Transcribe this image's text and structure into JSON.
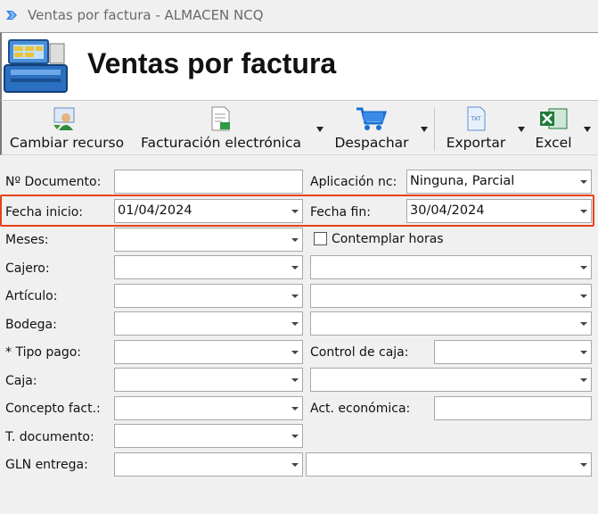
{
  "window": {
    "title": "Ventas por factura - ALMACEN NCQ"
  },
  "header": {
    "title": "Ventas por factura"
  },
  "toolbar": {
    "cambiar_recurso": "Cambiar recurso",
    "facturacion_electronica": "Facturación electrónica",
    "despachar": "Despachar",
    "exportar": "Exportar",
    "excel": "Excel"
  },
  "form": {
    "no_documento": {
      "label": "Nº Documento:",
      "value": ""
    },
    "aplicacion_nc": {
      "label": "Aplicación nc:",
      "value": "Ninguna, Parcial"
    },
    "fecha_inicio": {
      "label": "Fecha inicio:",
      "value": "01/04/2024"
    },
    "fecha_fin": {
      "label": "Fecha fin:",
      "value": "30/04/2024"
    },
    "meses": {
      "label": "Meses:",
      "value": ""
    },
    "contemplar_horas": {
      "label": "Contemplar horas",
      "checked": false
    },
    "cajero": {
      "label": "Cajero:",
      "value": "",
      "value2": ""
    },
    "articulo": {
      "label": "Artículo:",
      "value": "",
      "value2": ""
    },
    "bodega": {
      "label": "Bodega:",
      "value": "",
      "value2": ""
    },
    "tipo_pago": {
      "label": "* Tipo pago:",
      "value": ""
    },
    "control_caja": {
      "label": "Control de caja:",
      "value": ""
    },
    "caja": {
      "label": "Caja:",
      "value": "",
      "value2": ""
    },
    "concepto_fact": {
      "label": "Concepto fact.:",
      "value": ""
    },
    "act_economica": {
      "label": "Act. económica:",
      "value": ""
    },
    "t_documento": {
      "label": "T. documento:",
      "value": ""
    },
    "gln_entrega": {
      "label": "GLN entrega:",
      "value": "",
      "value2": ""
    }
  },
  "colors": {
    "highlight": "#e8401c",
    "excel_green": "#1f7a3a",
    "cart_blue": "#1a6fd6"
  }
}
